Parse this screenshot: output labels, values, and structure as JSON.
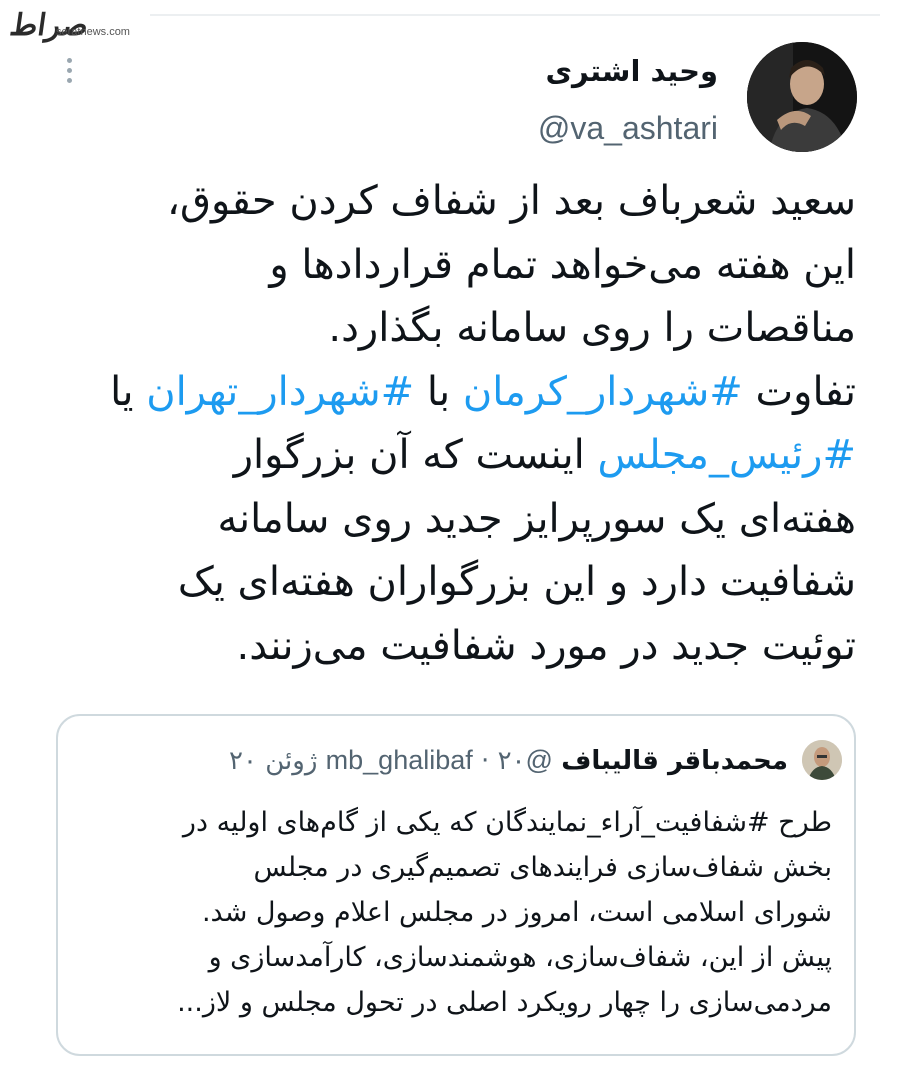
{
  "watermark": {
    "logo": "صراط",
    "site": "seratnews.com"
  },
  "tweet": {
    "author_name": "وحید اشتری",
    "author_handle": "@va_ashtari",
    "lines": [
      [
        {
          "t": "سعید شعرباف بعد از شفاف کردن حقوق،"
        }
      ],
      [
        {
          "t": "این هفته می‌خواهد تمام قراردادها و"
        }
      ],
      [
        {
          "t": "مناقصات را روی سامانه بگذارد."
        }
      ],
      [
        {
          "t": "تفاوت "
        },
        {
          "t": "#شهردار_کرمان",
          "tag": true
        },
        {
          "t": " با "
        },
        {
          "t": "#شهردار_تهران",
          "tag": true
        },
        {
          "t": " یا"
        }
      ],
      [
        {
          "t": "#رئیس_مجلس",
          "tag": true
        },
        {
          "t": " اینست که آن بزرگوار"
        }
      ],
      [
        {
          "t": "هفته‌ای یک سورپرایز جدید روی سامانه"
        }
      ],
      [
        {
          "t": "شفافیت دارد و این بزرگواران هفته‌ای یک"
        }
      ],
      [
        {
          "t": "توئیت جدید در مورد شفافیت می‌زنند."
        }
      ]
    ]
  },
  "quoted": {
    "author_name": "محمدباقر قالیباف",
    "author_handle": "@mb_ghalibaf",
    "separator": "·",
    "date": "۲۰ ژوئن ۲۰",
    "lines": [
      "طرح #شفافیت_آراء_نمایندگان که یکی از گام‌های اولیه در",
      "بخش شفاف‌سازی فرایندهای تصمیم‌گیری در مجلس",
      "شورای اسلامی است، امروز در مجلس اعلام وصول شد.",
      "پیش از این، شفاف‌سازی، هوشمندسازی، کارآمدسازی و",
      "مردمی‌سازی را چهار رویکرد اصلی در تحول مجلس و لاز..."
    ]
  },
  "colors": {
    "hashtag": "#1d9bf0",
    "muted": "#536471",
    "border": "#cfd9de"
  },
  "icons": {
    "more": "more-vertical-icon"
  }
}
